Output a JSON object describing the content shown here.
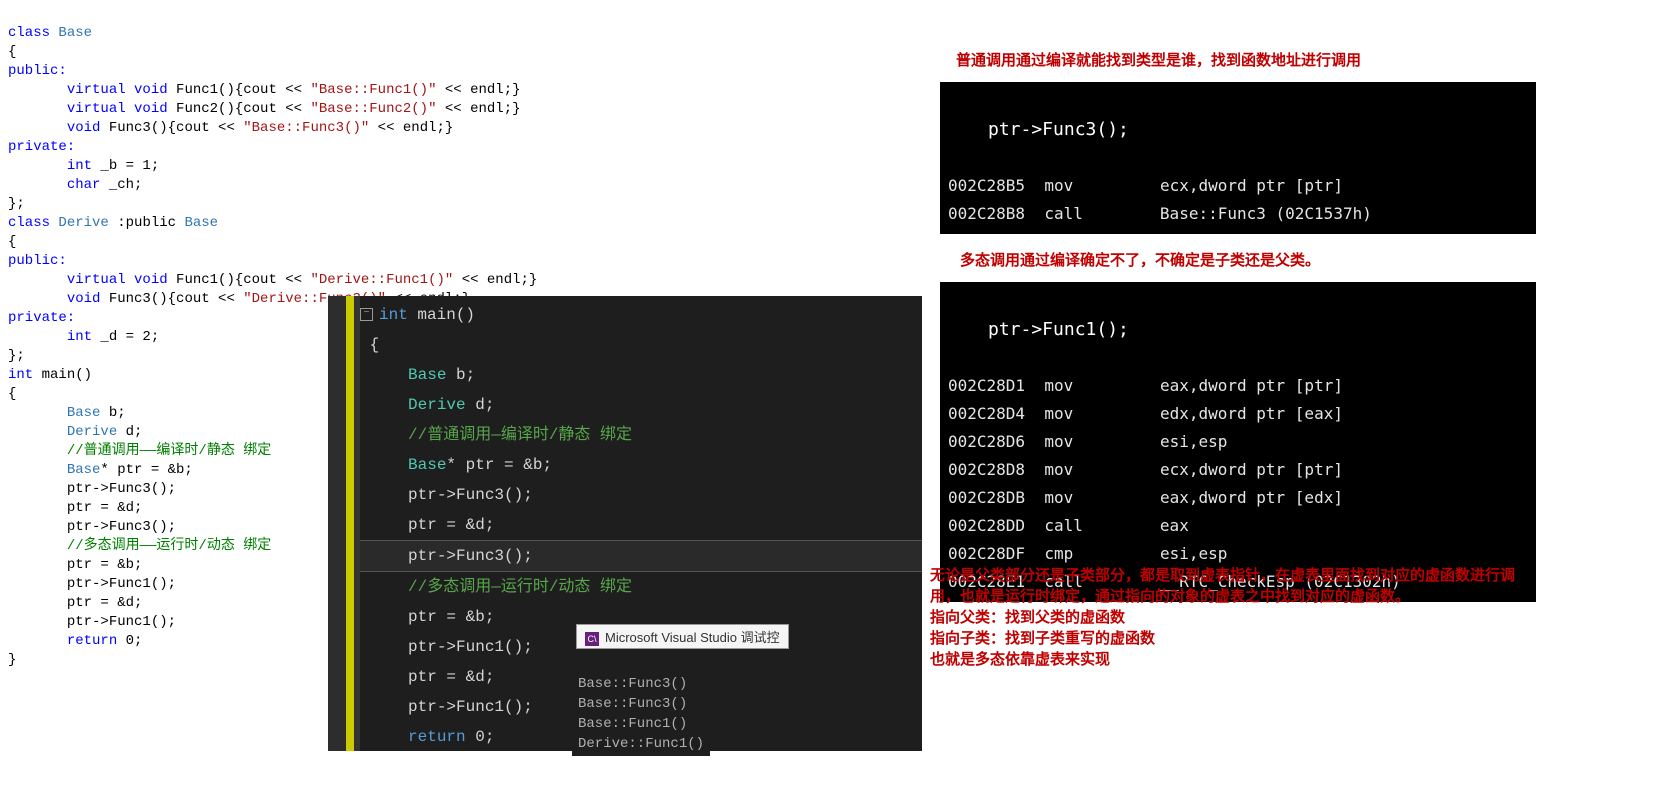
{
  "source": {
    "l1": "class ",
    "base": "Base",
    "l2": "{",
    "pub": "public:",
    "priv": "private:",
    "virtual": "virtual ",
    "void_kw": "void ",
    "int_kw": "int ",
    "char_kw": "char ",
    "ret": "return ",
    "f1": "Func1(){cout << ",
    "f2": "Func2(){cout << ",
    "f3_open": "Func3(){cout << ",
    "s_base_f1": "\"Base::Func1()\"",
    "s_base_f2": "\"Base::Func2()\"",
    "s_base_f3": "\"Base::Func3()\"",
    "endl_close": " << endl;}",
    "b_decl": "_b = 1;",
    "ch_decl": "_ch;",
    "close_sc": "};",
    "derive_line": "Derive",
    "derive_inh": " :public ",
    "s_der_f1": "\"Derive::Func1()\"",
    "s_der_f3": "\"Derive::Func3()\"",
    "d_decl": "_d = 2;",
    "main_decl": "main()",
    "base_b": "b;",
    "derive_d": "d;",
    "comment1": "//普通调用——编译时/静态 绑定",
    "base_ptr": "Base* ptr = &b;",
    "base_star": "Base",
    "ptr_eq_b": "* ptr = &b;",
    "ptr_f3": "ptr->Func3();",
    "ptr_d": "ptr = &d;",
    "comment2": "//多态调用——运行时/动态 绑定",
    "ptr_b": "ptr = &b;",
    "ptr_f1": "ptr->Func1();",
    "ret0": "0;"
  },
  "vs": {
    "int_kw": "int",
    "main": " main()",
    "brace_o": "{",
    "base": "Base",
    "b_semi": " b;",
    "derive": "Derive",
    "d_semi": " d;",
    "comment1": "//普通调用—编译时/静态 绑定",
    "base_ptr": "* ptr = &b;",
    "ptr_f3": "ptr->Func3();",
    "ptr_d": "ptr = &d;",
    "comment2": "//多态调用—运行时/动态 绑定",
    "ptr_b": "ptr = &b;",
    "ptr_f1": "ptr->Func1();",
    "ret": "return",
    "zero": " 0;"
  },
  "tooltip": {
    "title": "Microsoft Visual Studio 调试控"
  },
  "output": {
    "l1": "Base::Func3()",
    "l2": "Base::Func3()",
    "l3": "Base::Func1()",
    "l4": "Derive::Func1()"
  },
  "annot": {
    "top": "普通调用通过编译就能找到类型是谁，找到函数地址进行调用",
    "mid": "多态调用通过编译确定不了，不确定是子类还是父类。",
    "body1": "无论是父类部分还是子类部分，都是取到虚表指针，在虚表里面找到对应的虚函数进行调用，也就是运行时绑定，通过指向的对象的虚表之中找到对应的虚函数。",
    "body2": "指向父类：找到父类的虚函数",
    "body3": "指向子类：找到子类重写的虚函数",
    "body4": "也就是多态依靠虚表来实现"
  },
  "asm1": {
    "head": "ptr->Func3();",
    "r1": {
      "addr": "002C28B5",
      "op": "mov",
      "args": "ecx,dword ptr [ptr]"
    },
    "r2": {
      "addr": "002C28B8",
      "op": "call",
      "args": "Base::Func3 (02C1537h)"
    }
  },
  "asm2": {
    "head": "ptr->Func1();",
    "r1": {
      "addr": "002C28D1",
      "op": "mov",
      "args": "eax,dword ptr [ptr]"
    },
    "r2": {
      "addr": "002C28D4",
      "op": "mov",
      "args": "edx,dword ptr [eax]"
    },
    "r3": {
      "addr": "002C28D6",
      "op": "mov",
      "args": "esi,esp"
    },
    "r4": {
      "addr": "002C28D8",
      "op": "mov",
      "args": "ecx,dword ptr [ptr]"
    },
    "r5": {
      "addr": "002C28DB",
      "op": "mov",
      "args": "eax,dword ptr [edx]"
    },
    "r6": {
      "addr": "002C28DD",
      "op": "call",
      "args": "eax"
    },
    "r7": {
      "addr": "002C28DF",
      "op": "cmp",
      "args": "esi,esp"
    },
    "r8": {
      "addr": "002C28E1",
      "op": "call",
      "args": "__RTC_CheckEsp (02C1302h)"
    }
  }
}
